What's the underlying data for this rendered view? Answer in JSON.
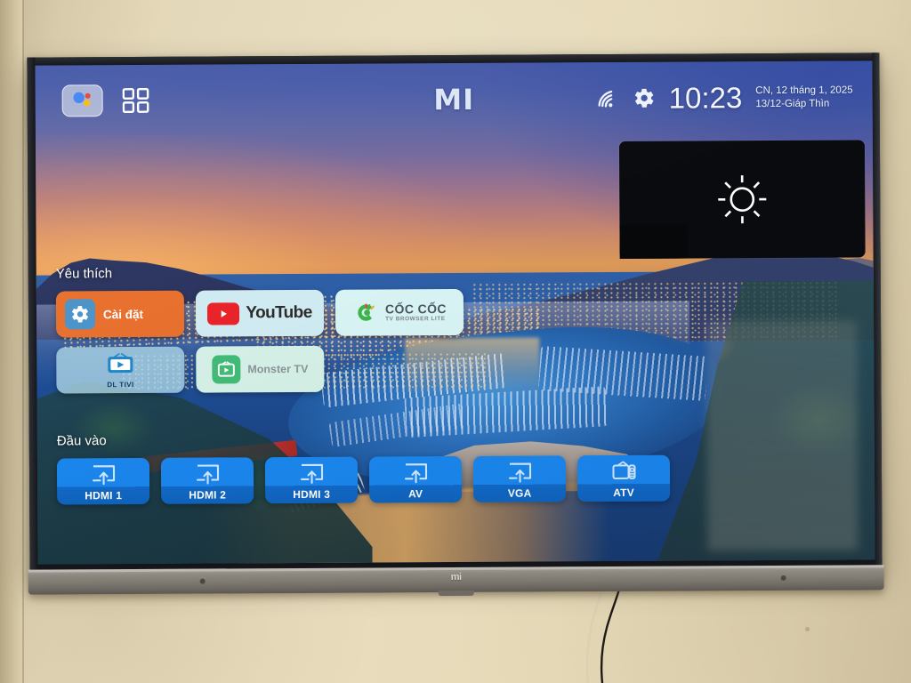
{
  "device": {
    "brand_logo": "MI",
    "chin_logo": "mi"
  },
  "statusbar": {
    "assistant_icon": "google-assistant-icon",
    "apps_grid_icon": "apps-grid-icon",
    "wifi_icon": "wifi-icon",
    "settings_icon": "gear-icon",
    "clock": "10:23",
    "date_gregorian": "CN, 12 tháng 1, 2025",
    "date_lunar": "13/12-Giáp Thìn"
  },
  "osd": {
    "name": "brightness-osd",
    "icon": "brightness-sun-icon"
  },
  "favourites": {
    "title": "Yêu thích",
    "row1": [
      {
        "id": "settings",
        "label": "Cài đặt",
        "icon": "gear-icon",
        "bg": "#e8702e"
      },
      {
        "id": "youtube",
        "label": "YouTube",
        "icon": "youtube-play-icon",
        "bg": "#cfeaf0"
      },
      {
        "id": "coccoc",
        "label": "CỐC CỐC",
        "sublabel": "TV BROWSER LITE",
        "icon": "coccoc-icon",
        "bg": "#d8f3f3"
      }
    ],
    "row2": [
      {
        "id": "dltivi",
        "label": "DL TIVI",
        "icon": "tv-play-icon",
        "bg": "#b0d8e8"
      },
      {
        "id": "monstertv",
        "label": "Monster TV",
        "icon": "tv-play-icon",
        "bg": "#d4f0e6"
      }
    ]
  },
  "inputs": {
    "title": "Đầu vào",
    "items": [
      {
        "id": "hdmi1",
        "label": "HDMI 1",
        "icon": "input-arrow-icon"
      },
      {
        "id": "hdmi2",
        "label": "HDMI 2",
        "icon": "input-arrow-icon"
      },
      {
        "id": "hdmi3",
        "label": "HDMI 3",
        "icon": "input-arrow-icon"
      },
      {
        "id": "av",
        "label": "AV",
        "icon": "input-arrow-icon"
      },
      {
        "id": "vga",
        "label": "VGA",
        "icon": "input-arrow-icon"
      },
      {
        "id": "atv",
        "label": "ATV",
        "icon": "antenna-tv-icon"
      }
    ]
  },
  "colors": {
    "accent_blue": "#1a86ed",
    "settings_orange": "#e8702e",
    "youtube_red": "#e8242a",
    "monster_green": "#42bb77",
    "coccoc_green": "#3cb54a",
    "wall": "#e3d7b8",
    "bezel": "#14161a",
    "chin": "#8e8a82"
  }
}
